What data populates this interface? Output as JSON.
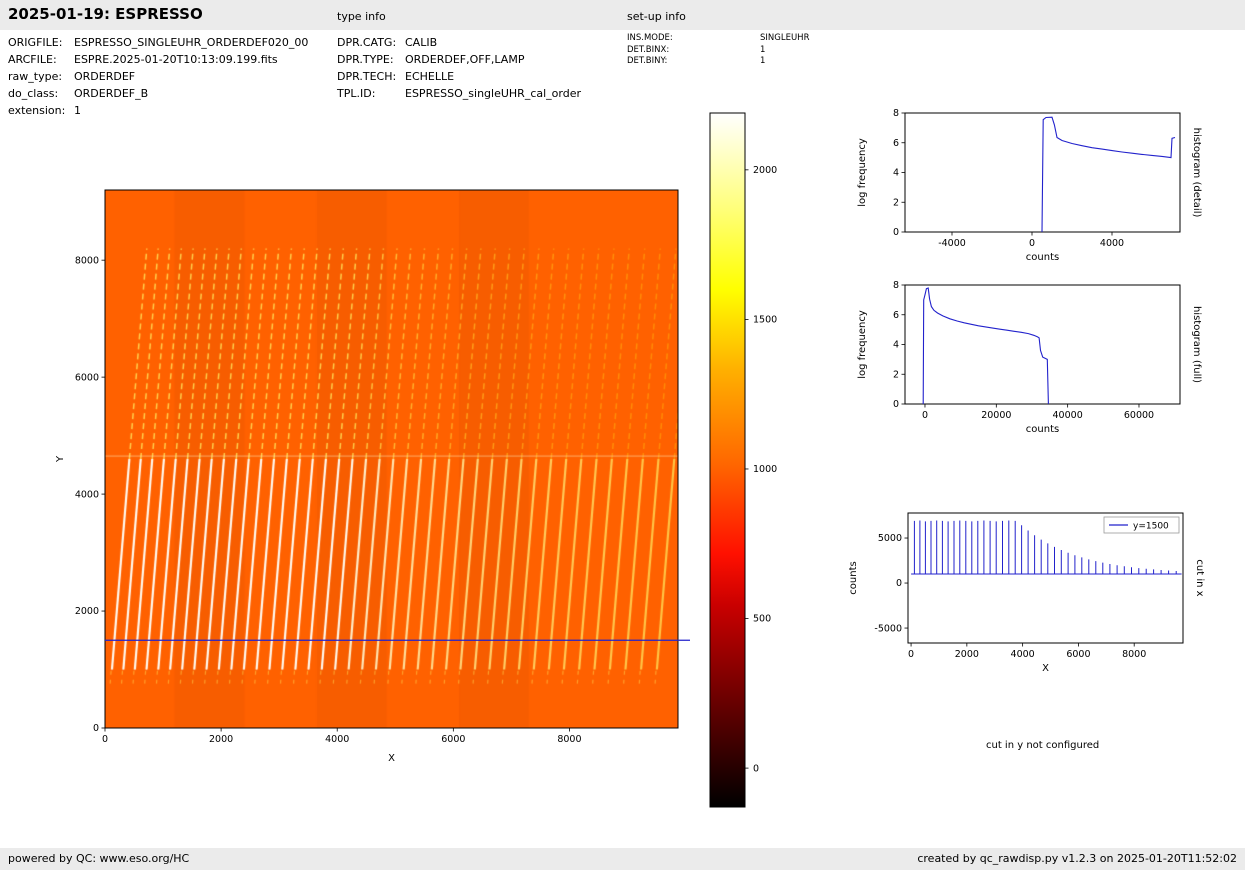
{
  "page": {
    "bar_color": "#ebebeb",
    "background": "#ffffff"
  },
  "header": {
    "title": "2025-01-19: ESPRESSO",
    "type_info": "type info",
    "setup_info": "set-up info"
  },
  "metadata": {
    "file_info": [
      {
        "key": "ORIGFILE:",
        "value": "ESPRESSO_SINGLEUHR_ORDERDEF020_00"
      },
      {
        "key": "ARCFILE:",
        "value": "ESPRE.2025-01-20T10:13:09.199.fits"
      },
      {
        "key": "raw_type:",
        "value": "ORDERDEF"
      },
      {
        "key": "do_class:",
        "value": "ORDERDEF_B"
      },
      {
        "key": "extension:",
        "value": "1"
      }
    ],
    "type_info": [
      {
        "key": "DPR.CATG:",
        "value": "CALIB"
      },
      {
        "key": "DPR.TYPE:",
        "value": "ORDERDEF,OFF,LAMP"
      },
      {
        "key": "DPR.TECH:",
        "value": "ECHELLE"
      },
      {
        "key": "TPL.ID:",
        "value": "ESPRESSO_singleUHR_cal_order"
      }
    ],
    "setup_info": [
      {
        "key": "INS.MODE:",
        "value": "SINGLEUHR"
      },
      {
        "key": "DET.BINX:",
        "value": "1"
      },
      {
        "key": "DET.BINY:",
        "value": "1"
      }
    ]
  },
  "notes": {
    "cut_y": "cut in y not configured"
  },
  "footer": {
    "left": "powered by QC: www.eso.org/HC",
    "right": "created by qc_rawdisp.py v1.2.3 on 2025-01-20T11:52:02"
  },
  "chart_data": [
    {
      "id": "raw_image",
      "type": "heatmap",
      "xlabel": "X",
      "ylabel": "Y",
      "xlim": [
        0,
        9870
      ],
      "ylim": [
        0,
        9200
      ],
      "xticks": [
        0,
        2000,
        4000,
        6000,
        8000
      ],
      "yticks": [
        0,
        2000,
        4000,
        6000,
        8000
      ],
      "background_value": 1000,
      "stripe_rows": {
        "bright_y": [
          1000,
          4600
        ],
        "faint_y": [
          4600,
          8200
        ],
        "below_y": [
          700,
          980
        ]
      },
      "tilt_x": 600,
      "seam_y": 4650,
      "shade_bands": [
        [
          1200,
          2400
        ],
        [
          3650,
          4850
        ],
        [
          6100,
          7300
        ]
      ],
      "cut_line": {
        "y": 1500,
        "color": "#2222cc"
      }
    },
    {
      "id": "colorbar",
      "type": "colorbar",
      "colormap": "hot",
      "vmin": -130,
      "vmax": 2190,
      "ticks": [
        0,
        500,
        1000,
        1500,
        2000
      ],
      "stops": [
        [
          0,
          "#000000"
        ],
        [
          0.15,
          "#680000"
        ],
        [
          0.29,
          "#c90000"
        ],
        [
          0.365,
          "#ff1000"
        ],
        [
          0.5,
          "#ff6a00"
        ],
        [
          0.63,
          "#ffb000"
        ],
        [
          0.746,
          "#ffff00"
        ],
        [
          0.86,
          "#ffff78"
        ],
        [
          1,
          "#ffffff"
        ]
      ]
    },
    {
      "id": "histogram_detail",
      "type": "line",
      "xlabel": "counts",
      "ylabel": "log frequency",
      "right_label": "histogram (detail)",
      "line_color": "#2222cc",
      "xlim": [
        -6350,
        7400
      ],
      "ylim": [
        0,
        8
      ],
      "xticks": [
        -4000,
        0,
        4000
      ],
      "yticks": [
        0,
        2,
        4,
        6,
        8
      ],
      "points": [
        [
          500,
          0
        ],
        [
          560,
          7.55
        ],
        [
          700,
          7.7
        ],
        [
          1000,
          7.72
        ],
        [
          1120,
          7.2
        ],
        [
          1250,
          6.35
        ],
        [
          1500,
          6.15
        ],
        [
          2000,
          5.95
        ],
        [
          2500,
          5.8
        ],
        [
          3000,
          5.67
        ],
        [
          3500,
          5.57
        ],
        [
          4000,
          5.47
        ],
        [
          4500,
          5.38
        ],
        [
          5000,
          5.3
        ],
        [
          5500,
          5.22
        ],
        [
          6000,
          5.15
        ],
        [
          6500,
          5.08
        ],
        [
          6850,
          5.02
        ],
        [
          6950,
          5.0
        ],
        [
          7000,
          6.3
        ],
        [
          7150,
          6.35
        ]
      ]
    },
    {
      "id": "histogram_full",
      "type": "line",
      "xlabel": "counts",
      "ylabel": "log frequency",
      "right_label": "histogram (full)",
      "line_color": "#2222cc",
      "xlim": [
        -5600,
        71500
      ],
      "ylim": [
        0,
        8
      ],
      "xticks": [
        0,
        20000,
        40000,
        60000
      ],
      "yticks": [
        0,
        2,
        4,
        6,
        8
      ],
      "points": [
        [
          -500,
          0
        ],
        [
          -350,
          7.0
        ],
        [
          0,
          7.35
        ],
        [
          400,
          7.75
        ],
        [
          900,
          7.8
        ],
        [
          1300,
          7.05
        ],
        [
          1800,
          6.55
        ],
        [
          2500,
          6.3
        ],
        [
          3500,
          6.12
        ],
        [
          5000,
          5.92
        ],
        [
          7000,
          5.73
        ],
        [
          9000,
          5.58
        ],
        [
          11000,
          5.46
        ],
        [
          13000,
          5.36
        ],
        [
          15000,
          5.26
        ],
        [
          17000,
          5.18
        ],
        [
          19000,
          5.1
        ],
        [
          21000,
          5.03
        ],
        [
          23000,
          4.96
        ],
        [
          25000,
          4.89
        ],
        [
          27000,
          4.82
        ],
        [
          29000,
          4.73
        ],
        [
          30500,
          4.62
        ],
        [
          31500,
          4.52
        ],
        [
          32000,
          4.45
        ],
        [
          32400,
          3.6
        ],
        [
          33000,
          3.15
        ],
        [
          34300,
          3.0
        ],
        [
          34600,
          0
        ]
      ]
    },
    {
      "id": "cut_in_x",
      "type": "comb",
      "xlabel": "X",
      "ylabel": "counts",
      "right_label": "cut in x",
      "legend": {
        "label": "y=1500"
      },
      "line_color": "#2222cc",
      "xlim": [
        -110,
        9750
      ],
      "ylim": [
        -6660,
        7780
      ],
      "xticks": [
        0,
        2000,
        4000,
        6000,
        8000
      ],
      "yticks": [
        -5000,
        0,
        5000
      ],
      "baseline": 1000,
      "x_start": 0,
      "x_end": 9700,
      "spikes": [
        [
          120,
          6900
        ],
        [
          316,
          6950
        ],
        [
          514,
          6850
        ],
        [
          715,
          6900
        ],
        [
          918,
          6950
        ],
        [
          1122,
          6900
        ],
        [
          1329,
          6850
        ],
        [
          1538,
          6900
        ],
        [
          1748,
          6950
        ],
        [
          1961,
          6900
        ],
        [
          2176,
          6850
        ],
        [
          2392,
          6900
        ],
        [
          2611,
          6950
        ],
        [
          2832,
          6900
        ],
        [
          3054,
          6850
        ],
        [
          3279,
          6900
        ],
        [
          3505,
          6950
        ],
        [
          3734,
          6900
        ],
        [
          3964,
          6430
        ],
        [
          4196,
          5840
        ],
        [
          4430,
          5310
        ],
        [
          4667,
          4830
        ],
        [
          4904,
          4400
        ],
        [
          5144,
          4010
        ],
        [
          5386,
          3670
        ],
        [
          5629,
          3360
        ],
        [
          5875,
          3090
        ],
        [
          6122,
          2850
        ],
        [
          6371,
          2630
        ],
        [
          6622,
          2440
        ],
        [
          6875,
          2270
        ],
        [
          7130,
          2120
        ],
        [
          7386,
          1980
        ],
        [
          7645,
          1860
        ],
        [
          7905,
          1760
        ],
        [
          8167,
          1660
        ],
        [
          8431,
          1580
        ],
        [
          8697,
          1510
        ],
        [
          8965,
          1450
        ],
        [
          9234,
          1390
        ],
        [
          9506,
          1340
        ]
      ]
    }
  ]
}
